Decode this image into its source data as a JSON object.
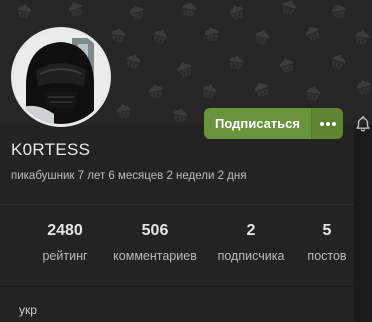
{
  "profile": {
    "username": "K0RTESS",
    "tenure": "пикабушник 7 лет 6 месяцев 2 недели 2 дня",
    "about": "укр"
  },
  "actions": {
    "subscribe_label": "Подписаться",
    "more_icon": "more-dots-icon",
    "bell_icon": "bell-icon"
  },
  "stats": [
    {
      "value": "2480",
      "label": "рейтинг"
    },
    {
      "value": "506",
      "label": "комментариев"
    },
    {
      "value": "2",
      "label": "подписчика"
    },
    {
      "value": "5",
      "label": "постов"
    }
  ],
  "colors": {
    "accent": "#69933c",
    "background": "#1b1b1b",
    "panel": "#232323"
  }
}
